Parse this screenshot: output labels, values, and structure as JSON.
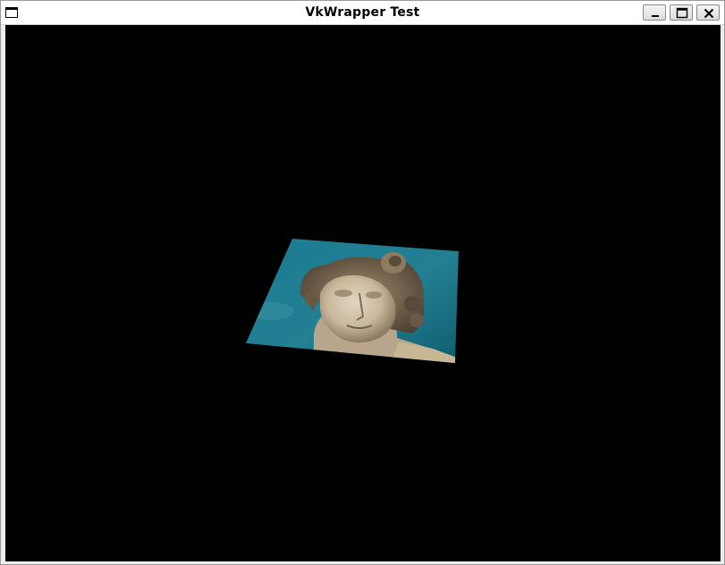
{
  "window": {
    "title": "VkWrapper Test",
    "buttons": [
      "minimize",
      "maximize",
      "close"
    ]
  },
  "viewport": {
    "background": "#000000",
    "content": "textured-quad-marble-statue-head"
  },
  "colors": {
    "sky_teal": "#1f7f93",
    "sky_dark": "#0f4f60",
    "marble_light": "#d8cab3",
    "marble_shadow": "#7a6a55"
  }
}
